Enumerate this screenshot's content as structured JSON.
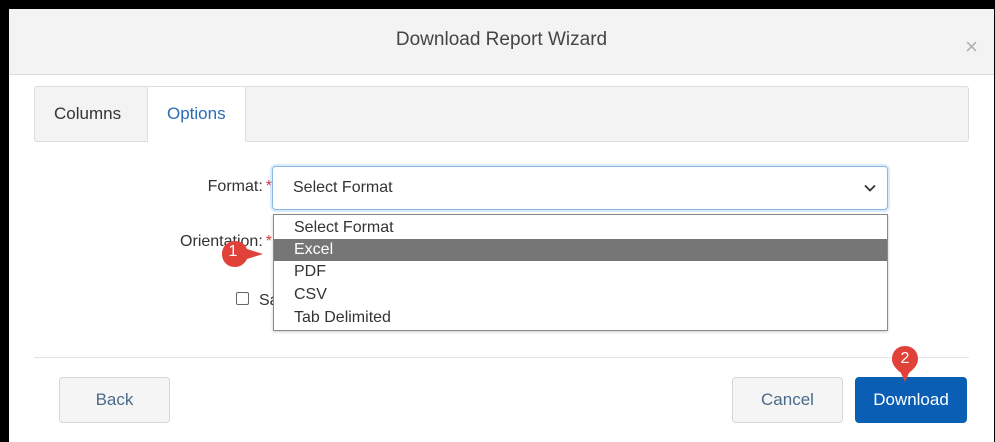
{
  "dialog": {
    "title": "Download Report Wizard",
    "close_glyph": "×"
  },
  "tabs": [
    {
      "label": "Columns",
      "active": false
    },
    {
      "label": "Options",
      "active": true
    }
  ],
  "form": {
    "format_label": "Format:",
    "orientation_label": "Orientation:",
    "required_mark": "*",
    "format_value": "Select Format",
    "checkbox_label_partial": "Sa"
  },
  "dropdown": {
    "options": [
      "Select Format",
      "Excel",
      "PDF",
      "CSV",
      "Tab Delimited"
    ],
    "highlighted": "Excel"
  },
  "buttons": {
    "back": "Back",
    "cancel": "Cancel",
    "download": "Download"
  },
  "annotations": {
    "marker_1": "1",
    "marker_2": "2"
  },
  "colors": {
    "primary": "#0a5fb4",
    "annotation_red": "#e0423a",
    "highlight": "#767676",
    "required": "#d13b3b"
  }
}
